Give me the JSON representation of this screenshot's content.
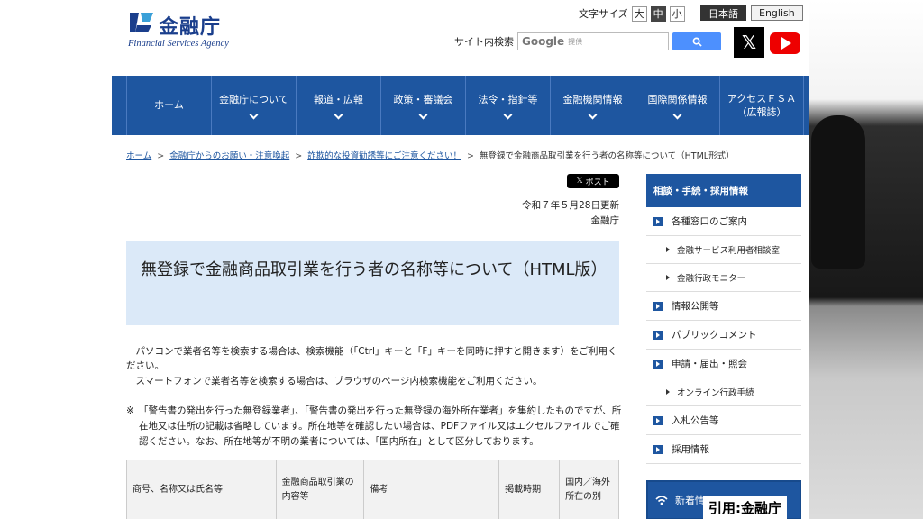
{
  "header": {
    "logo_jp": "金融庁",
    "logo_en": "Financial Services Agency",
    "font_size_label": "文字サイズ",
    "font_sizes": [
      "大",
      "中",
      "小"
    ],
    "lang_jp": "日本語",
    "lang_en": "English",
    "search_label": "サイト内検索",
    "google_logo": "Google",
    "google_sub": "提供"
  },
  "nav": [
    {
      "label": "ホーム",
      "has_dropdown": false
    },
    {
      "label": "金融庁について",
      "has_dropdown": true
    },
    {
      "label": "報道・広報",
      "has_dropdown": true
    },
    {
      "label": "政策・審議会",
      "has_dropdown": true
    },
    {
      "label": "法令・指針等",
      "has_dropdown": true
    },
    {
      "label": "金融機関情報",
      "has_dropdown": true
    },
    {
      "label": "国際関係情報",
      "has_dropdown": true
    },
    {
      "label": "アクセスＦＳＡ\n（広報誌）",
      "has_dropdown": false
    }
  ],
  "breadcrumb": {
    "items": [
      "ホーム",
      "金融庁からのお願い・注意喚起",
      "詐欺的な投資勧誘等にご注意ください！"
    ],
    "current": "無登録で金融商品取引業を行う者の名称等について（HTML形式）"
  },
  "main": {
    "post_label": "ポスト",
    "updated": "令和７年５月28日更新",
    "author": "金融庁",
    "title": "無登録で金融商品取引業を行う者の名称等について（HTML版）",
    "para1": "パソコンで業者名等を検索する場合は、検索機能（「Ctrl」キーと「F」キーを同時に押すと開きます）をご利用ください。",
    "para2": "スマートフォンで業者名等を検索する場合は、ブラウザのページ内検索機能をご利用ください。",
    "note_mark": "※",
    "note": "「警告書の発出を行った無登録業者」、「警告書の発出を行った無登録の海外所在業者」を集約したものですが、所在地又は住所の記載は省略しています。所在地等を確認したい場合は、PDFファイル又はエクセルファイルでご確認ください。なお、所在地等が不明の業者については、「国内所在」として区分しております。",
    "table_headers": [
      "商号、名称又は氏名等",
      "金融商品取引業の内容等",
      "備考",
      "掲載時期",
      "国内／海外所在の別"
    ]
  },
  "sidebar": {
    "heading": "相談・手続・採用情報",
    "items": [
      {
        "label": "各種窓口のご案内",
        "level": 1
      },
      {
        "label": "金融サービス利用者相談室",
        "level": 2
      },
      {
        "label": "金融行政モニター",
        "level": 2
      },
      {
        "label": "情報公開等",
        "level": 1
      },
      {
        "label": "パブリックコメント",
        "level": 1
      },
      {
        "label": "申請・届出・照会",
        "level": 1
      },
      {
        "label": "オンライン行政手続",
        "level": 2
      },
      {
        "label": "入札公告等",
        "level": 1
      },
      {
        "label": "採用情報",
        "level": 1
      }
    ],
    "news_label": "新着情"
  },
  "credit": "引用:金融庁",
  "colors": {
    "brand_blue": "#1e56a0",
    "title_bg": "#dbe9f8"
  }
}
